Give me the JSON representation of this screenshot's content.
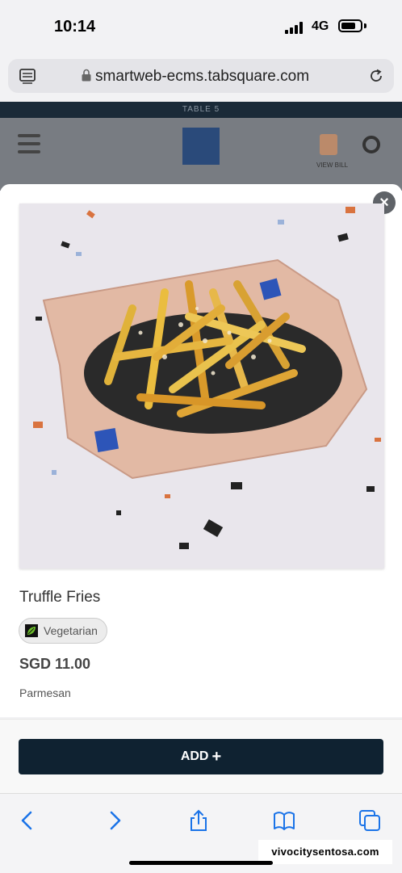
{
  "status_bar": {
    "time": "10:14",
    "network": "4G"
  },
  "browser": {
    "url": "smartweb-ecms.tabsquare.com"
  },
  "background_page": {
    "table_label": "TABLE 5",
    "bill_label": "VIEW BILL"
  },
  "product": {
    "name": "Truffle Fries",
    "tag": "Vegetarian",
    "price": "SGD 11.00",
    "description": "Parmesan",
    "image_icon": "fries-photo"
  },
  "actions": {
    "add_label": "ADD",
    "add_icon": "plus-icon"
  },
  "watermark": "vivocitysentosa.com",
  "colors": {
    "accent": "#0f2231",
    "close": "#5f6368",
    "background": "#f2f2f4"
  }
}
